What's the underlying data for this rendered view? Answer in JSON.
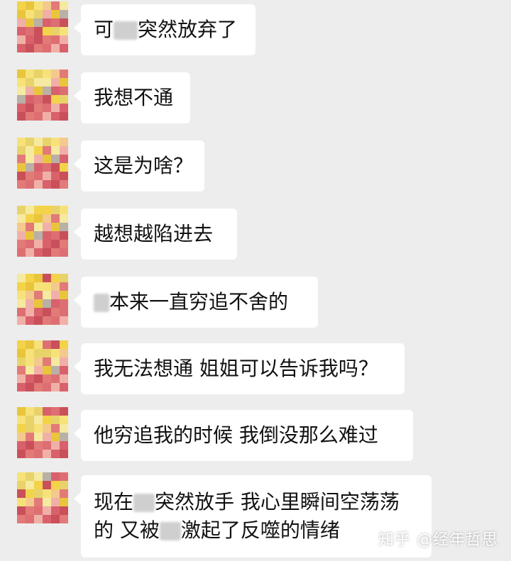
{
  "messages": [
    {
      "parts": [
        "可",
        "",
        "突然放弃了"
      ],
      "redact": [
        1
      ]
    },
    {
      "parts": [
        "我想不通"
      ]
    },
    {
      "parts": [
        "这是为啥？"
      ]
    },
    {
      "parts": [
        "越想越陷进去"
      ]
    },
    {
      "parts": [
        "",
        "本来一直穷追不舍的"
      ],
      "redact": [
        0
      ]
    },
    {
      "parts": [
        "我无法想通 姐姐可以告诉我吗？"
      ]
    },
    {
      "parts": [
        "他穷追我的时候 我倒没那么难过"
      ]
    },
    {
      "line1": [
        "现在",
        "",
        "突然放手 我心里瞬间空荡荡"
      ],
      "line2": [
        "的 又被",
        "",
        "激起了反噬的情绪"
      ]
    }
  ],
  "watermark": "知乎 @经年哲思",
  "colors": {
    "background": "#ededed",
    "bubble": "#ffffff",
    "text": "#111111"
  },
  "avatar": {
    "name": "pixelated-avatar"
  }
}
